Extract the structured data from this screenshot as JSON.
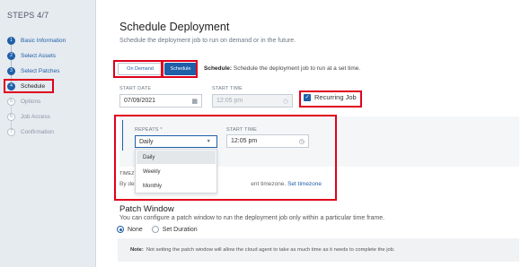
{
  "sidebar": {
    "title": "STEPS 4/7",
    "steps": [
      {
        "num": "1",
        "label": "Basic Information"
      },
      {
        "num": "2",
        "label": "Select Assets"
      },
      {
        "num": "3",
        "label": "Select Patches"
      },
      {
        "num": "4",
        "label": "Schedule"
      },
      {
        "num": "5",
        "label": "Options"
      },
      {
        "num": "6",
        "label": "Job Access"
      },
      {
        "num": "7",
        "label": "Confirmation"
      }
    ]
  },
  "header": {
    "title": "Schedule Deployment",
    "subtitle": "Schedule the deployment job to run on demand or in the future."
  },
  "mode": {
    "on_demand_label": "On Demand",
    "schedule_label": "Schedule",
    "desc_bold": "Schedule:",
    "desc_text": " Schedule the deployment job to run at a set time."
  },
  "start": {
    "date_label": "START DATE",
    "date_value": "07/09/2021",
    "time_label": "START TIME",
    "time_value": "12:05 pm",
    "recurring_label": "Recurring Job"
  },
  "recurring": {
    "repeats_label": "REPEATS *",
    "repeats_value": "Daily",
    "start_time_label": "START TIME",
    "start_time_value": "12:05 pm",
    "options": [
      "Daily",
      "Weekly",
      "Monthly"
    ]
  },
  "timezone": {
    "label": "TIMEZ",
    "text_start": "By de",
    "text_end": "ent timezone.",
    "link": "Set timezone"
  },
  "patch_window": {
    "title": "Patch Window",
    "subtitle": "You can configure a patch window to run the deployment job only within a particular time frame.",
    "radio_none": "None",
    "radio_duration": "Set Duration",
    "note_bold": "Note:",
    "note_text": "Not setting the patch window will allow the cloud agent to take as much time as it needs to complete the job."
  },
  "colors": {
    "accent": "#1f5fa8",
    "highlight": "#e0001b",
    "sidebar_bg": "#e6ebf0"
  }
}
